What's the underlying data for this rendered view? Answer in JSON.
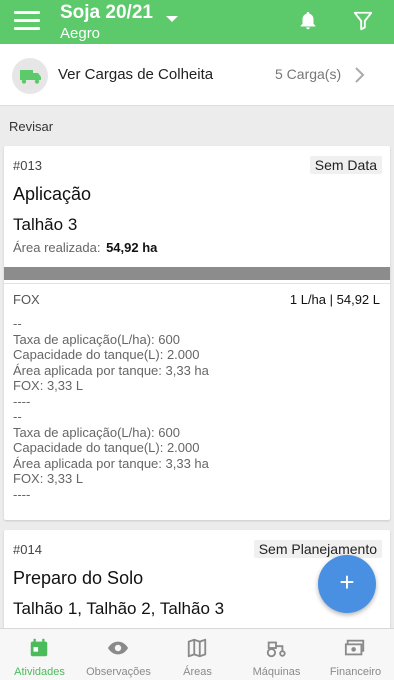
{
  "header": {
    "title": "Soja 20/21",
    "subtitle": "Aegro",
    "menu_icon": "menu-icon",
    "bell_icon": "bell-icon",
    "filter_icon": "filter-icon"
  },
  "cargas": {
    "label": "Ver Cargas de Colheita",
    "count": "5 Carga(s)",
    "icon": "truck-icon"
  },
  "section": {
    "title": "Revisar"
  },
  "cards": [
    {
      "code": "#013",
      "badge": "Sem Data",
      "activity": "Aplicação",
      "plots": "Talhão 3",
      "area_label": "Área realizada:",
      "area_value": "54,92 ha",
      "product": "FOX",
      "dose": "1 L/ha | 54,92 L",
      "notes": [
        "--",
        "Taxa de aplicação(L/ha): 600",
        "Capacidade do tanque(L): 2.000",
        "Área aplicada por tanque: 3,33 ha",
        "FOX: 3,33 L",
        "----",
        "--",
        "Taxa de aplicação(L/ha): 600",
        "Capacidade do tanque(L): 2.000",
        "Área aplicada por tanque: 3,33 ha",
        "FOX: 3,33 L",
        "----"
      ]
    },
    {
      "code": "#014",
      "badge": "Sem Planejamento",
      "activity": "Preparo do Solo",
      "plots": "Talhão 1, Talhão 2, Talhão 3"
    }
  ],
  "fab": {
    "label": "+"
  },
  "nav": {
    "items": [
      {
        "label": "Atividades",
        "icon": "calendar-icon",
        "active": true
      },
      {
        "label": "Observações",
        "icon": "eye-icon",
        "active": false
      },
      {
        "label": "Áreas",
        "icon": "map-icon",
        "active": false
      },
      {
        "label": "Máquinas",
        "icon": "tractor-icon",
        "active": false
      },
      {
        "label": "Financeiro",
        "icon": "money-icon",
        "active": false
      }
    ]
  },
  "colors": {
    "brand_green": "#5cc96a",
    "active_green": "#4cbb5c",
    "fab_blue": "#4a90e2"
  }
}
